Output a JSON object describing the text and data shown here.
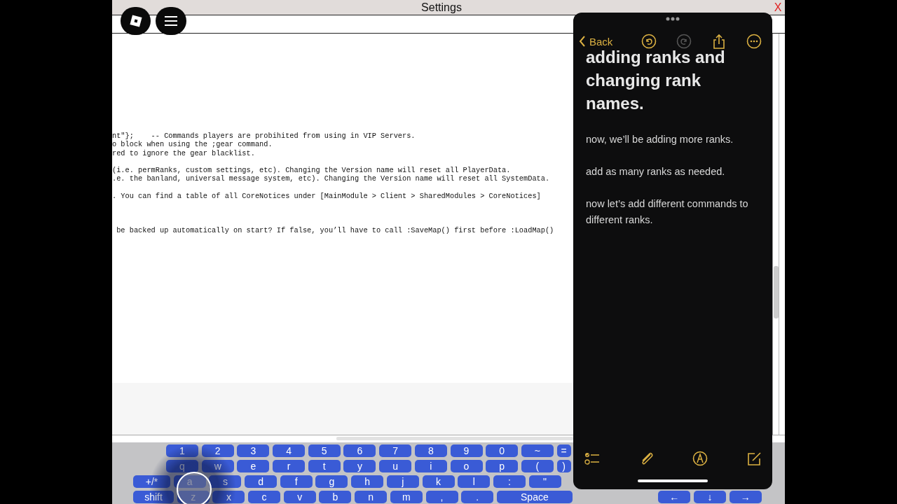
{
  "window": {
    "title": "Settings",
    "close": "X"
  },
  "editor": {
    "blocks": [
      [
        "nt\"};    -- Commands players are probihited from using in VIP Servers.",
        "o block when using the ;gear command.",
        "red to ignore the gear blacklist."
      ],
      [
        "(i.e. permRanks, custom settings, etc). Changing the Version name will reset all PlayerData.",
        ".e. the banland, universal message system, etc). Changing the Version name will reset all SystemData."
      ],
      [
        ". You can find a table of all CoreNotices under [MainModule > Client > SharedModules > CoreNotices]"
      ],
      [
        " be backed up automatically on start? If false, you’ll have to call :SaveMap() first before :LoadMap()"
      ]
    ]
  },
  "keyboard": {
    "rows": [
      [
        "1",
        "2",
        "3",
        "4",
        "5",
        "6",
        "7",
        "8",
        "9",
        "0",
        "~",
        "="
      ],
      [
        "q",
        "w",
        "e",
        "r",
        "t",
        "y",
        "u",
        "i",
        "o",
        "p",
        "(",
        ")"
      ],
      [
        "+/*",
        "a",
        "s",
        "d",
        "f",
        "g",
        "h",
        "j",
        "k",
        "l",
        ":",
        "\""
      ],
      [
        "shift",
        "z",
        "x",
        "c",
        "v",
        "b",
        "n",
        "m",
        ",",
        ".",
        "Space"
      ]
    ],
    "arrow_keys": [
      "←",
      "↓",
      "→"
    ]
  },
  "notes": {
    "back": "Back",
    "toolbar": [
      {
        "kind": "undo",
        "disabled": false
      },
      {
        "kind": "redo",
        "disabled": true
      },
      {
        "kind": "share",
        "disabled": false
      },
      {
        "kind": "more",
        "disabled": false
      }
    ],
    "title": "adding ranks and changing rank names.",
    "paragraphs": [
      "now, we’ll be adding more ranks.",
      "add as many ranks as needed.",
      "now let’s add different commands to different ranks."
    ],
    "bottom_toolbar": [
      {
        "kind": "checklist"
      },
      {
        "kind": "attach"
      },
      {
        "kind": "markup"
      },
      {
        "kind": "compose"
      }
    ]
  }
}
